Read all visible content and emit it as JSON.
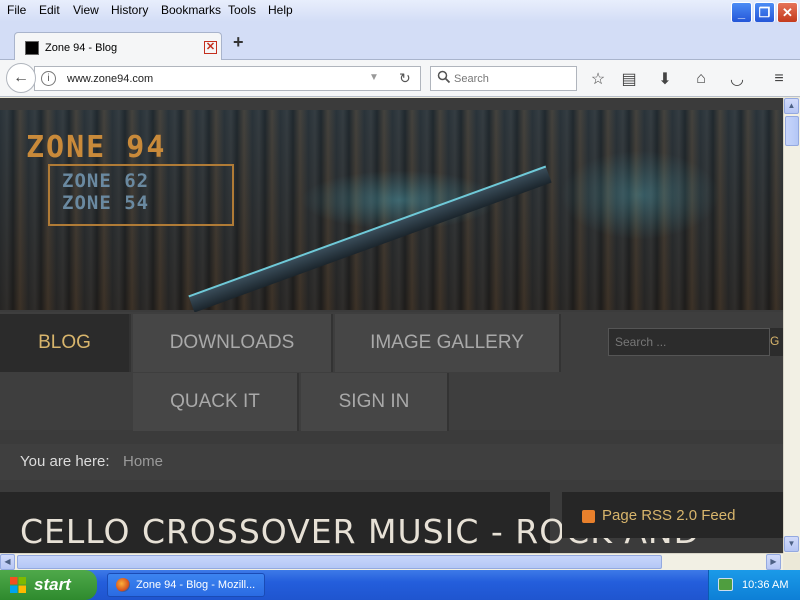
{
  "menubar": {
    "items": [
      "File",
      "Edit",
      "View",
      "History",
      "Bookmarks",
      "Tools",
      "Help"
    ]
  },
  "window_controls": {
    "minimize": "minimize",
    "maximize": "maximize",
    "close": "close"
  },
  "tab": {
    "title": "Zone 94 - Blog",
    "new_tab": "+"
  },
  "navbar": {
    "url": "www.zone94.com",
    "search_placeholder": "Search"
  },
  "site": {
    "logo": "ZONE 94",
    "sublogo": [
      "ZONE 62",
      "ZONE 54"
    ],
    "nav": [
      "BLOG",
      "DOWNLOADS",
      "IMAGE GALLERY",
      "QUACK IT",
      "SIGN IN"
    ],
    "active_nav": "BLOG",
    "search_placeholder": "Search ...",
    "breadcrumb_label": "You are here:",
    "breadcrumb_home": "Home",
    "article_title": "CELLO CROSSOVER MUSIC - ROCK AND",
    "rss_label": "Page RSS 2.0 Feed"
  },
  "taskbar": {
    "start": "start",
    "task_item": "Zone 94 - Blog - Mozill...",
    "clock": "10:36 AM"
  },
  "colors": {
    "accent": "#d8b56c",
    "logo": "#c98a3a",
    "taskbar": "#245edc",
    "start": "#3a9a3a"
  }
}
